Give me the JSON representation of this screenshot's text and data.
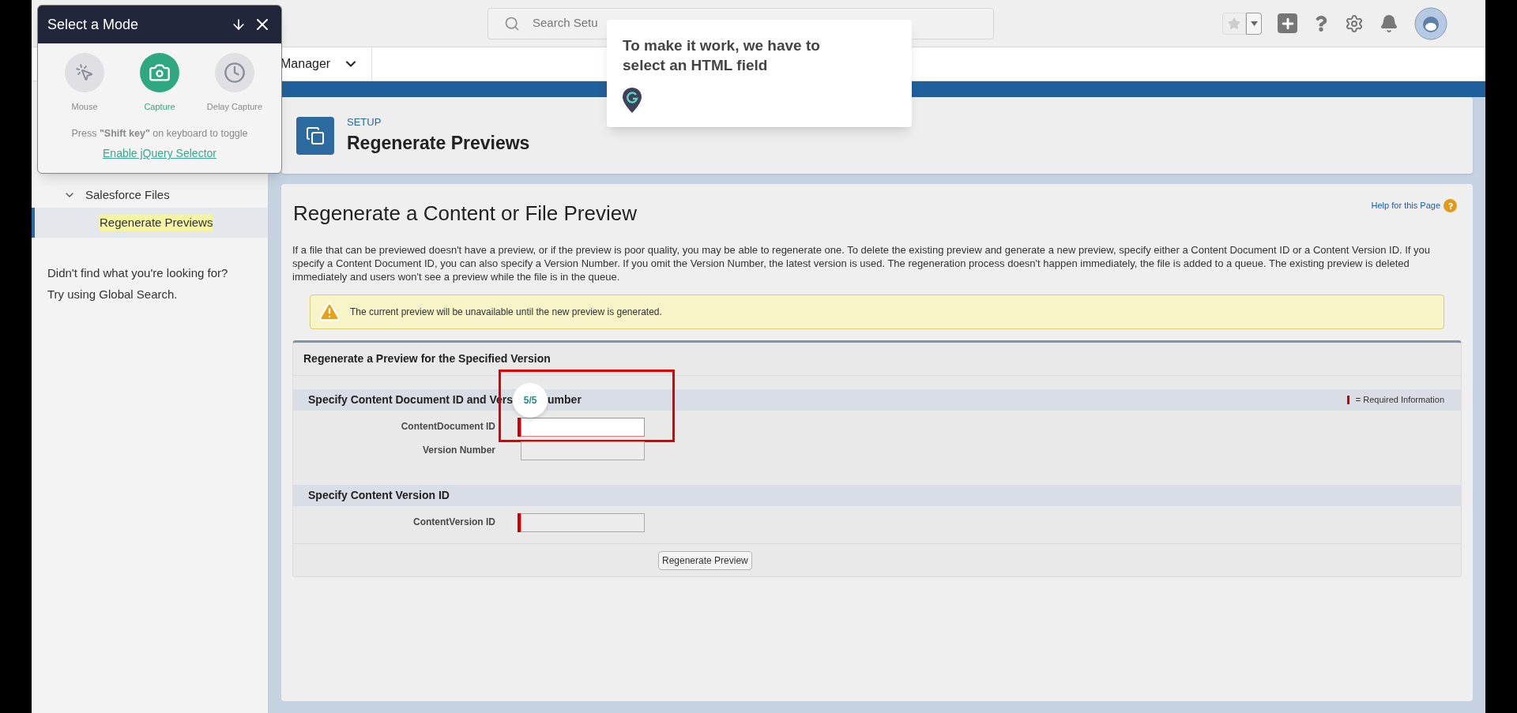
{
  "mode_panel": {
    "title": "Select a Mode",
    "modes": [
      {
        "label": "Mouse",
        "kind": "mouse",
        "selected": false
      },
      {
        "label": "Capture",
        "kind": "camera",
        "selected": true
      },
      {
        "label": "Delay Capture",
        "kind": "clock",
        "selected": false
      }
    ],
    "hint": "Press **\"Shift key\"** on keyboard to toggle",
    "link": "Enable jQuery Selector"
  },
  "header": {
    "search": {
      "placeholder": "Search Setu"
    }
  },
  "nav": {
    "tab": "Manager"
  },
  "tooltip": {
    "text": "To make it work, we have to select an HTML field"
  },
  "sidebar": {
    "items": [
      {
        "label": "Salesforce Files",
        "expanded": true,
        "children": [
          {
            "label": "Regenerate Previews",
            "selected": true
          }
        ]
      }
    ],
    "help_lines": [
      "Didn't find what you're looking for?",
      "Try using Global Search."
    ]
  },
  "page_header": {
    "eyebrow": "SETUP",
    "title": "Regenerate Previews"
  },
  "content": {
    "title": "Regenerate a Content or File Preview",
    "help_link": "Help for this Page",
    "description": "If a file that can be previewed doesn't have a preview, or if the preview is poor quality, you may be able to regenerate one. To delete the existing preview and generate a new preview, specify either a Content Document ID or a Content Version ID. If you specify a Content Document ID, you can also specify a Version Number. If you omit the Version Number, the latest version is used. The regeneration process doesn't happen immediately, the file is added to a queue. The existing preview is deleted immediately and users won't see a preview while the file is in the queue.",
    "warning": "The current preview will be unavailable until the new preview is generated."
  },
  "form": {
    "title": "Regenerate a Preview for the Specified Version",
    "sections": [
      {
        "heading_parts": [
          "Specify Content Document ID and Vers",
          "umber"
        ],
        "step_badge": "5/5",
        "required_legend": "= Required Information",
        "fields": [
          {
            "label": "ContentDocument ID",
            "required": true,
            "focused": true
          },
          {
            "label": "Version Number",
            "required": false,
            "focused": false
          }
        ]
      },
      {
        "heading_parts": [
          "Specify Content Version ID"
        ],
        "fields": [
          {
            "label": "ContentVersion ID",
            "required": true,
            "focused": false
          }
        ]
      }
    ],
    "button": "Regenerate Preview"
  }
}
